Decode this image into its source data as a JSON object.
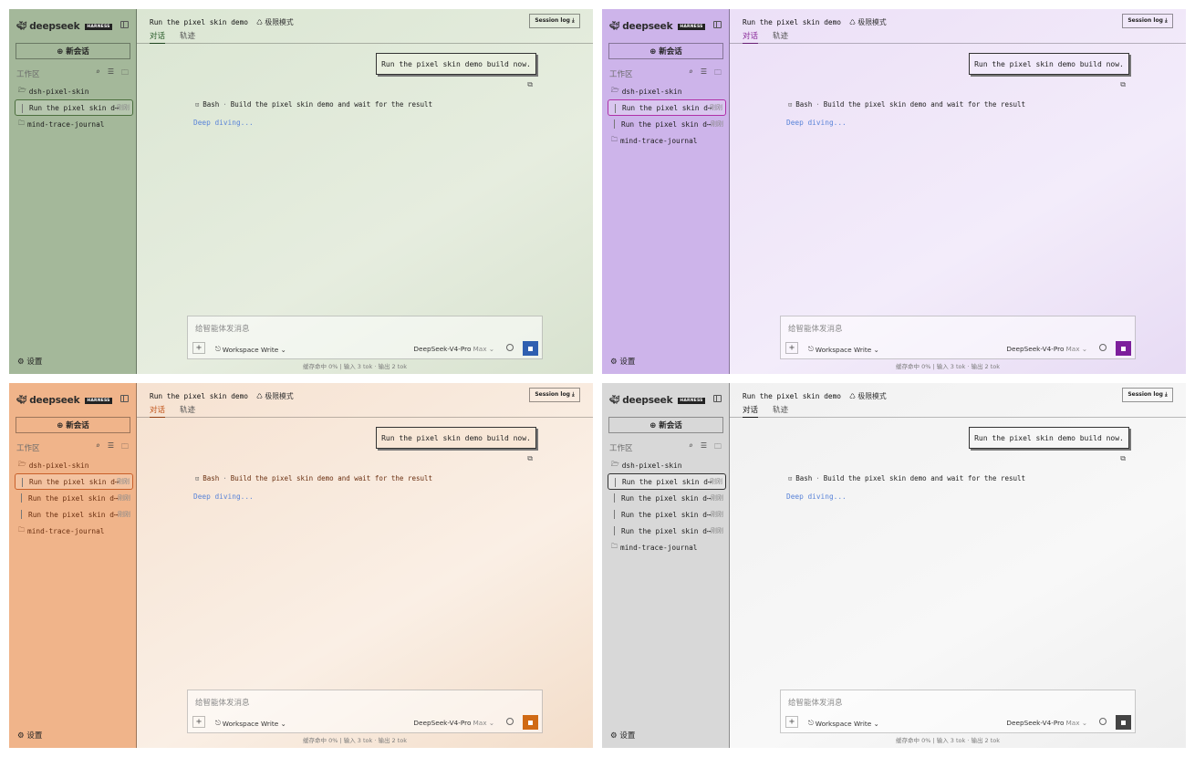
{
  "panels": [
    {
      "theme": "green",
      "brand": {
        "name": "deepseek",
        "badge": "HARNESS"
      },
      "new_chat_label": "⊕ 新会话",
      "workspace_label": "工作区",
      "settings_label": "⚙ 设置",
      "tree": [
        {
          "type": "project",
          "icon": "🗁",
          "label": "dsh-pixel-skin"
        },
        {
          "type": "session",
          "label": "Run the pixel skin d⋯",
          "time": "刚刚",
          "active": true
        },
        {
          "type": "project",
          "icon": "🗀",
          "label": "mind-trace-journal"
        }
      ],
      "header": {
        "title": "Run the pixel skin demo",
        "mode": "♺ 极限模式",
        "session_log": "Session log ⤓",
        "tabs": [
          "对话",
          "轨迹"
        ]
      },
      "chat": {
        "user_message": "Run the pixel skin demo build now.",
        "tool_name": "Bash",
        "tool_desc": "Build the pixel skin demo and wait for the result",
        "thinking": "Deep diving..."
      },
      "composer": {
        "placeholder": "给智能体发消息",
        "mode": "Workspace Write ⌄",
        "model": "DeepSeek-V4-Pro",
        "effort": "Max ⌄"
      },
      "usage": "缓存命中 0% | 输入 3 tok · 输出 2 tok"
    },
    {
      "theme": "purple",
      "brand": {
        "name": "deepseek",
        "badge": "HARNESS"
      },
      "new_chat_label": "⊕ 新会话",
      "workspace_label": "工作区",
      "settings_label": "⚙ 设置",
      "tree": [
        {
          "type": "project",
          "icon": "🗁",
          "label": "dsh-pixel-skin"
        },
        {
          "type": "session",
          "label": "Run the pixel skin d⋯",
          "time": "刚刚",
          "active": true
        },
        {
          "type": "session",
          "label": "Run the pixel skin d⋯",
          "time": "刚刚",
          "active": false
        },
        {
          "type": "project",
          "icon": "🗀",
          "label": "mind-trace-journal"
        }
      ],
      "header": {
        "title": "Run the pixel skin demo",
        "mode": "♺ 极限模式",
        "session_log": "Session log ⤓",
        "tabs": [
          "对话",
          "轨迹"
        ]
      },
      "chat": {
        "user_message": "Run the pixel skin demo build now.",
        "tool_name": "Bash",
        "tool_desc": "Build the pixel skin demo and wait for the result",
        "thinking": "Deep diving..."
      },
      "composer": {
        "placeholder": "给智能体发消息",
        "mode": "Workspace Write ⌄",
        "model": "DeepSeek-V4-Pro",
        "effort": "Max ⌄"
      },
      "usage": "缓存命中 0% | 输入 3 tok · 输出 2 tok"
    },
    {
      "theme": "orange",
      "brand": {
        "name": "deepseek",
        "badge": "HARNESS"
      },
      "new_chat_label": "⊕ 新会话",
      "workspace_label": "工作区",
      "settings_label": "⚙ 设置",
      "tree": [
        {
          "type": "project",
          "icon": "🗁",
          "label": "dsh-pixel-skin"
        },
        {
          "type": "session",
          "label": "Run the pixel skin d⋯",
          "time": "刚刚",
          "active": true
        },
        {
          "type": "session",
          "label": "Run the pixel skin d⋯",
          "time": "刚刚",
          "active": false
        },
        {
          "type": "session",
          "label": "Run the pixel skin d⋯",
          "time": "刚刚",
          "active": false
        },
        {
          "type": "project",
          "icon": "🗀",
          "label": "mind-trace-journal"
        }
      ],
      "header": {
        "title": "Run the pixel skin demo",
        "mode": "♺ 极限模式",
        "session_log": "Session log ⤓",
        "tabs": [
          "对话",
          "轨迹"
        ]
      },
      "chat": {
        "user_message": "Run the pixel skin demo build now.",
        "tool_name": "Bash",
        "tool_desc": "Build the pixel skin demo and wait for the result",
        "thinking": "Deep diving..."
      },
      "composer": {
        "placeholder": "给智能体发消息",
        "mode": "Workspace Write ⌄",
        "model": "DeepSeek-V4-Pro",
        "effort": "Max ⌄"
      },
      "usage": "缓存命中 0% | 输入 3 tok · 输出 2 tok"
    },
    {
      "theme": "gray",
      "brand": {
        "name": "deepseek",
        "badge": "HARNESS"
      },
      "new_chat_label": "⊕ 新会话",
      "workspace_label": "工作区",
      "settings_label": "⚙ 设置",
      "tree": [
        {
          "type": "project",
          "icon": "🗁",
          "label": "dsh-pixel-skin"
        },
        {
          "type": "session",
          "label": "Run the pixel skin d⋯",
          "time": "刚刚",
          "active": true
        },
        {
          "type": "session",
          "label": "Run the pixel skin d⋯",
          "time": "刚刚",
          "active": false
        },
        {
          "type": "session",
          "label": "Run the pixel skin d⋯",
          "time": "刚刚",
          "active": false
        },
        {
          "type": "session",
          "label": "Run the pixel skin d⋯",
          "time": "刚刚",
          "active": false
        },
        {
          "type": "project",
          "icon": "🗀",
          "label": "mind-trace-journal"
        }
      ],
      "header": {
        "title": "Run the pixel skin demo",
        "mode": "♺ 极限模式",
        "session_log": "Session log ⤓",
        "tabs": [
          "对话",
          "轨迹"
        ]
      },
      "chat": {
        "user_message": "Run the pixel skin demo build now.",
        "tool_name": "Bash",
        "tool_desc": "Build the pixel skin demo and wait for the result",
        "thinking": "Deep diving..."
      },
      "composer": {
        "placeholder": "给智能体发消息",
        "mode": "Workspace Write ⌄",
        "model": "DeepSeek-V4-Pro",
        "effort": "Max ⌄"
      },
      "usage": "缓存命中 0% | 输入 3 tok · 输出 2 tok"
    }
  ]
}
